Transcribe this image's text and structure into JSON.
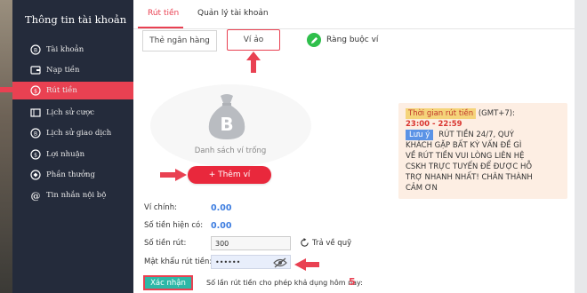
{
  "sidebar": {
    "title": "Thông tin tài khoản",
    "items": [
      {
        "label": "Tài khoản"
      },
      {
        "label": "Nạp tiền"
      },
      {
        "label": "Rút tiền"
      },
      {
        "label": "Lịch sử cược"
      },
      {
        "label": "Lịch sử giao dịch"
      },
      {
        "label": "Lợi nhuận"
      },
      {
        "label": "Phần thưởng"
      },
      {
        "label": "Tin nhắn nội bộ"
      }
    ],
    "active_color": "#e94152"
  },
  "tabs": {
    "withdraw": "Rút tiền",
    "accounts": "Quản lý tài khoản"
  },
  "withdraw_types": {
    "bank_card": "Thẻ ngân hàng",
    "e_wallet": "Ví ảo",
    "bind_wallet": "Ràng buộc ví"
  },
  "empty_state": {
    "text": "Danh sách ví trống",
    "add_button": "+ Thêm ví"
  },
  "notice": {
    "title": "Thời gian rút tiền",
    "timezone": "(GMT+7):",
    "hours": "23:00 - 22:59",
    "badge": "Lưu ý",
    "line1": "RÚT TIỀN 24/7, QUÝ",
    "line2": "KHÁCH GẶP BẤT KỲ VẤN ĐỀ GÌ",
    "line3": "VỀ RÚT TIỀN VUI LÒNG LIÊN HỆ",
    "line4": "CSKH TRỰC TUYẾN ĐỂ ĐƯỢC HỖ",
    "line5": "TRỢ NHANH NHẤT! CHÂN THÀNH",
    "line6": "CẢM ƠN"
  },
  "form": {
    "main_wallet_label": "Ví chính:",
    "main_wallet_value": "0.00",
    "available_label": "Số tiền hiện có:",
    "available_value": "0.00",
    "amount_label": "Số tiền rút:",
    "amount_value": "300",
    "return_label": "Trả về quỹ",
    "password_label": "Mật khẩu rút tiền:",
    "password_value": "••••••",
    "confirm_button": "Xác nhận",
    "remaining_label": "Số lần rút tiền cho phép khả dụng hôm nay:",
    "remaining_count": "5"
  },
  "colors": {
    "accent": "#e94152",
    "sidebar_bg": "#242b3b",
    "balance_blue": "#3d7de0",
    "confirm_bg": "#2db8a7",
    "wallet_green": "#2fbf4c"
  },
  "icons": [
    "bitcoin-bag-icon",
    "pencil-icon",
    "eye-slash-icon",
    "refresh-icon",
    "red-arrow-icon"
  ]
}
